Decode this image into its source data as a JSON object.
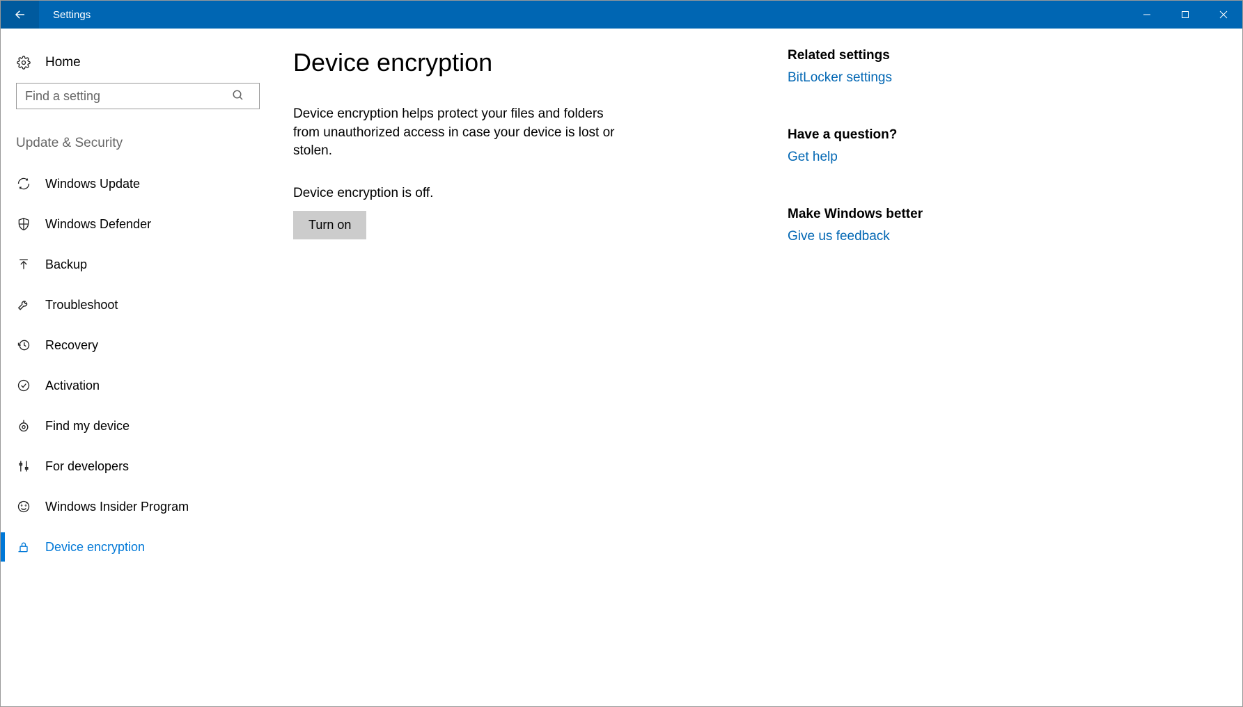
{
  "titlebar": {
    "title": "Settings"
  },
  "sidebar": {
    "home_label": "Home",
    "search_placeholder": "Find a setting",
    "category_label": "Update & Security",
    "items": [
      {
        "label": "Windows Update",
        "icon": "refresh",
        "active": false
      },
      {
        "label": "Windows Defender",
        "icon": "shield",
        "active": false
      },
      {
        "label": "Backup",
        "icon": "arrow-up-bar",
        "active": false
      },
      {
        "label": "Troubleshoot",
        "icon": "wrench",
        "active": false
      },
      {
        "label": "Recovery",
        "icon": "history",
        "active": false
      },
      {
        "label": "Activation",
        "icon": "check-circle",
        "active": false
      },
      {
        "label": "Find my device",
        "icon": "location",
        "active": false
      },
      {
        "label": "For developers",
        "icon": "sliders",
        "active": false
      },
      {
        "label": "Windows Insider Program",
        "icon": "insider",
        "active": false
      },
      {
        "label": "Device encryption",
        "icon": "lock",
        "active": true
      }
    ]
  },
  "main": {
    "heading": "Device encryption",
    "description": "Device encryption helps protect your files and folders from unauthorized access in case your device is lost or stolen.",
    "status": "Device encryption is off.",
    "button_label": "Turn on"
  },
  "right": {
    "sections": [
      {
        "title": "Related settings",
        "link": "BitLocker settings"
      },
      {
        "title": "Have a question?",
        "link": "Get help"
      },
      {
        "title": "Make Windows better",
        "link": "Give us feedback"
      }
    ]
  }
}
